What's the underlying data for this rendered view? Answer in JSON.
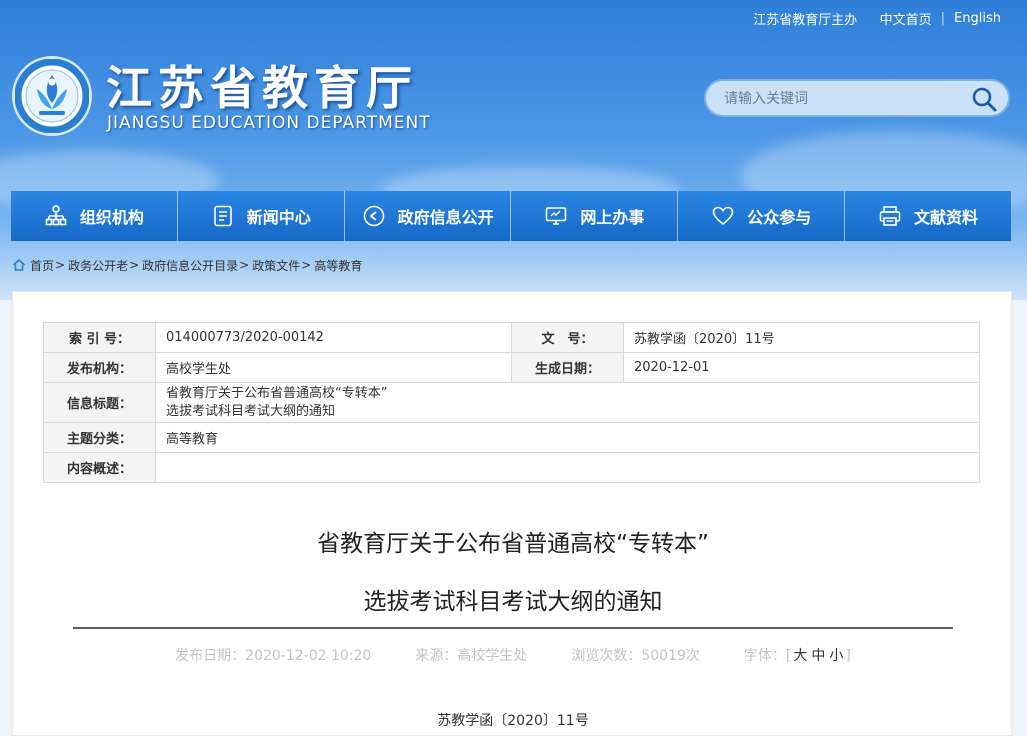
{
  "toplinks": {
    "sponsor": "江苏省教育厅主办",
    "home_cn": "中文首页",
    "english": "English",
    "separator": "|"
  },
  "header": {
    "title": "江苏省教育厅",
    "subtitle": "JIANGSU EDUCATION DEPARTMENT"
  },
  "search": {
    "placeholder": "请输入关键词",
    "icon": "search-icon"
  },
  "nav": [
    {
      "label": "组织机构",
      "icon": "org-chart-icon"
    },
    {
      "label": "新闻中心",
      "icon": "document-icon"
    },
    {
      "label": "政府信息公开",
      "icon": "play-circle-icon"
    },
    {
      "label": "网上办事",
      "icon": "monitor-icon"
    },
    {
      "label": "公众参与",
      "icon": "heart-icon"
    },
    {
      "label": "文献资料",
      "icon": "printer-icon"
    }
  ],
  "breadcrumb": {
    "icon": "home-icon",
    "items": [
      "首页",
      "政务公开老",
      "政府信息公开目录",
      "政策文件",
      "高等教育"
    ],
    "separator": ">"
  },
  "meta": {
    "index_no_label": "索 引 号：",
    "index_no": "014000773/2020-00142",
    "doc_no_label": "文　号：",
    "doc_no": "苏教学函〔2020〕11号",
    "issuer_label": "发布机构：",
    "issuer": "高校学生处",
    "created_label": "生成日期：",
    "created": "2020-12-01",
    "info_title_label": "信息标题：",
    "info_title_line1": "省教育厅关于公布省普通高校“专转本”",
    "info_title_line2": "选拔考试科目考试大纲的通知",
    "topic_label": "主题分类：",
    "topic": "高等教育",
    "summary_label": "内容概述：",
    "summary": ""
  },
  "article": {
    "title_line1": "省教育厅关于公布省普通高校“专转本”",
    "title_line2": "选拔考试科目考试大纲的通知",
    "publish": "发布日期：2020-12-02 10:20",
    "source": "来源：高校学生处",
    "views": "浏览次数：50019次",
    "font_label": "字体：[",
    "font_large": "大",
    "font_medium": "中",
    "font_small": "小",
    "font_end": "]",
    "doc_number": "苏教学函〔2020〕11号"
  },
  "colors": {
    "nav_bg": "#1e76d4",
    "header_top": "#2f7fd8",
    "label_bg": "#f4f4f4"
  }
}
